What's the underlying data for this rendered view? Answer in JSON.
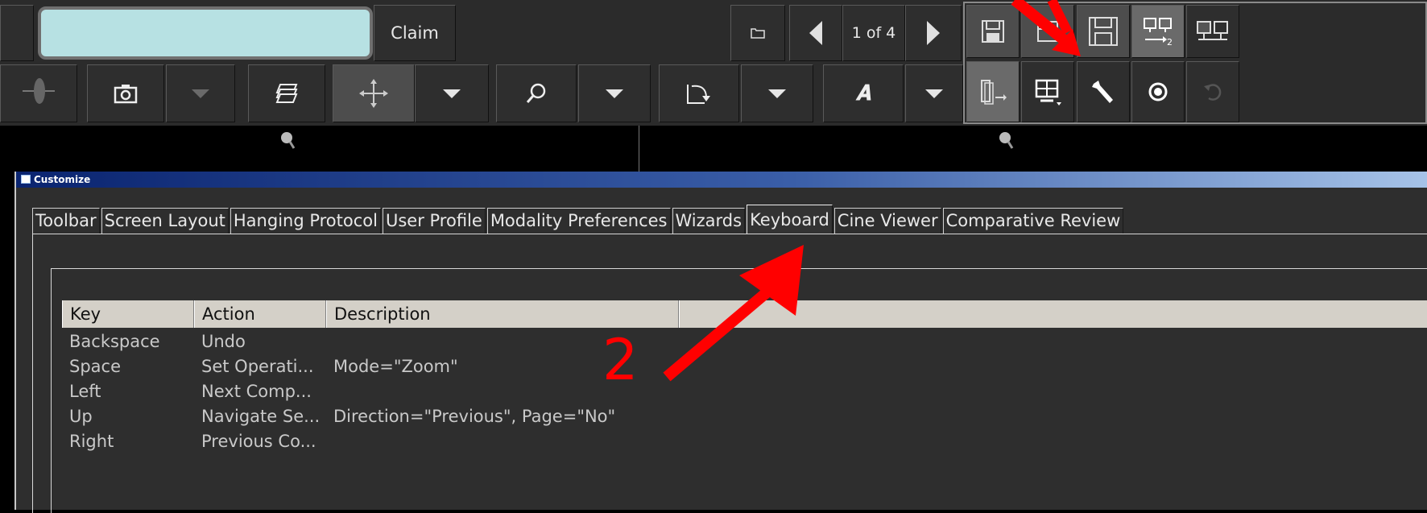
{
  "toolbar": {
    "claim_label": "Claim",
    "page_indicator": "1 of 4"
  },
  "icons": {
    "folder": "folder-icon",
    "prev": "left-triangle-icon",
    "next": "right-triangle-icon",
    "hanging": "hanging-layout-icon",
    "save": "floppy-disk-icon",
    "save2": "floppy-disk-icon-2",
    "monitors2": "dual-monitor-icon",
    "monitors": "monitor-pair-icon",
    "camera": "camera-icon",
    "stack": "image-stack-icon",
    "pan": "pan-move-icon",
    "zoom": "magnifier-icon",
    "rotate": "rotate-icon",
    "annotate": "text-annotation-icon",
    "export": "export-series-icon",
    "layout": "screen-layout-icon",
    "wrench": "wrench-icon",
    "record": "record-dot-icon",
    "undo": "undo-icon"
  },
  "dialog": {
    "title": "Customize",
    "tabs": [
      {
        "label": "Toolbar"
      },
      {
        "label": "Screen Layout"
      },
      {
        "label": "Hanging Protocol"
      },
      {
        "label": "User Profile"
      },
      {
        "label": "Modality Preferences"
      },
      {
        "label": "Wizards"
      },
      {
        "label": "Keyboard",
        "active": true
      },
      {
        "label": "Cine Viewer"
      },
      {
        "label": "Comparative Review"
      }
    ],
    "table": {
      "columns": [
        "Key",
        "Action",
        "Description"
      ],
      "rows": [
        {
          "key": "Backspace",
          "action": "Undo",
          "description": ""
        },
        {
          "key": "Space",
          "action": "Set Operati...",
          "description": "Mode=\"Zoom\""
        },
        {
          "key": "Left",
          "action": "Next Comp...",
          "description": ""
        },
        {
          "key": "Up",
          "action": "Navigate Se...",
          "description": "Direction=\"Previous\", Page=\"No\""
        },
        {
          "key": "Right",
          "action": "Previous Co...",
          "description": ""
        }
      ]
    }
  },
  "annotation": {
    "number": "2",
    "color": "#ff0000"
  },
  "colors": {
    "toolbar_bg": "#2b2b2b",
    "input_fill": "#b7e1e3",
    "titlebar_start": "#0a2470"
  }
}
